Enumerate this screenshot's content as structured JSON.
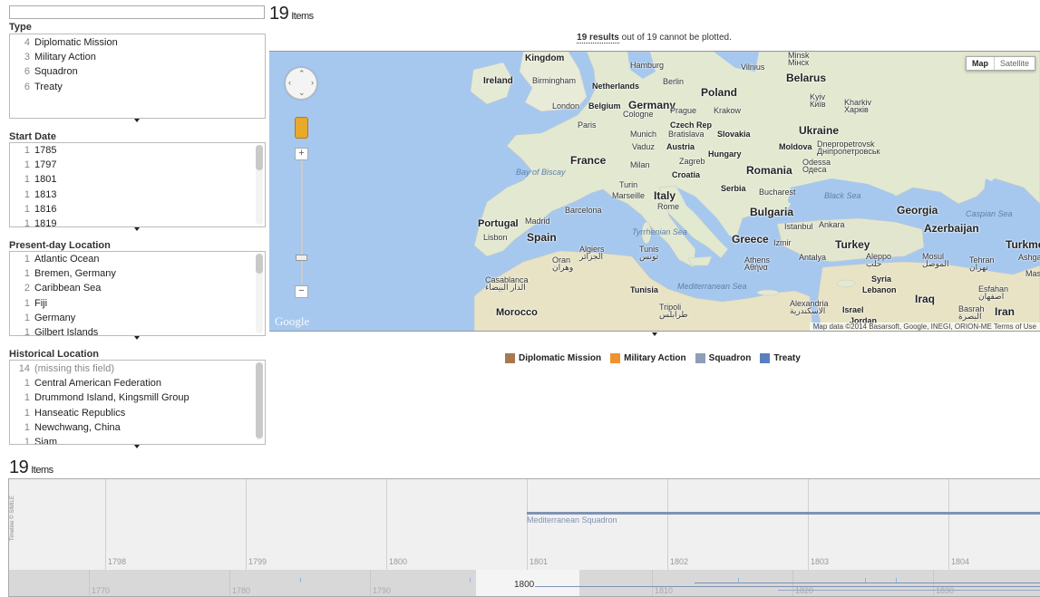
{
  "header": {
    "items_count": "19",
    "items_word": "Items"
  },
  "facets": {
    "type": {
      "title": "Type",
      "rows": [
        {
          "count": "4",
          "label": "Diplomatic Mission"
        },
        {
          "count": "3",
          "label": "Military Action"
        },
        {
          "count": "6",
          "label": "Squadron"
        },
        {
          "count": "6",
          "label": "Treaty"
        }
      ]
    },
    "start_date": {
      "title": "Start Date",
      "rows": [
        {
          "count": "1",
          "label": "1785"
        },
        {
          "count": "1",
          "label": "1797"
        },
        {
          "count": "1",
          "label": "1801"
        },
        {
          "count": "1",
          "label": "1813"
        },
        {
          "count": "1",
          "label": "1816"
        },
        {
          "count": "1",
          "label": "1819"
        }
      ]
    },
    "present_location": {
      "title": "Present-day Location",
      "rows": [
        {
          "count": "1",
          "label": "Atlantic Ocean"
        },
        {
          "count": "1",
          "label": "Bremen, Germany"
        },
        {
          "count": "2",
          "label": "Caribbean Sea"
        },
        {
          "count": "1",
          "label": "Fiji"
        },
        {
          "count": "1",
          "label": "Germany"
        },
        {
          "count": "1",
          "label": "Gilbert Islands"
        }
      ]
    },
    "historical_location": {
      "title": "Historical Location",
      "rows": [
        {
          "count": "14",
          "label": "(missing this field)"
        },
        {
          "count": "1",
          "label": "Central American Federation"
        },
        {
          "count": "1",
          "label": "Drummond Island, Kingsmill Group"
        },
        {
          "count": "1",
          "label": "Hanseatic Republics"
        },
        {
          "count": "1",
          "label": "Newchwang, China"
        },
        {
          "count": "1",
          "label": "Siam"
        }
      ]
    }
  },
  "map": {
    "results_link": "19 results",
    "results_rest": " out of 19 cannot be plotted.",
    "type_map": "Map",
    "type_satellite": "Satellite",
    "logo": "Google",
    "attribution": "Map data ©2014 Basarsoft, Google, INEGI, ORION-ME    Terms of Use",
    "labels": {
      "kingdom": "Kingdom",
      "ireland": "Ireland",
      "birmingham": "Birmingham",
      "london": "London",
      "netherlands": "Netherlands",
      "hamburg": "Hamburg",
      "berlin": "Berlin",
      "belgium": "Belgium",
      "germany": "Germany",
      "cologne": "Cologne",
      "poland": "Poland",
      "vilnius": "Vilnius",
      "minsk": "Minsk\nМінск",
      "belarus": "Belarus",
      "prague": "Prague",
      "krakow": "Krakow",
      "czech": "Czech Rep",
      "kyiv": "Kyiv\nКиїв",
      "kharkiv": "Kharkiv\nХарків",
      "paris": "Paris",
      "munich": "Munich",
      "bratislava": "Bratislava",
      "slovakia": "Slovakia",
      "vaduz": "Vaduz",
      "austria": "Austria",
      "ukraine": "Ukraine",
      "moldova": "Moldova",
      "dnipro": "Dnepropetrovsk\nДніпропетровськ",
      "france": "France",
      "milan": "Milan",
      "zagreb": "Zagreb",
      "hungary": "Hungary",
      "croatia": "Croatia",
      "romania": "Romania",
      "odessa": "Odessa\nОдеса",
      "biscay": "Bay of Biscay",
      "turin": "Turin",
      "serbia": "Serbia",
      "bucharest": "Bucharest",
      "marseille": "Marseille",
      "italy": "Italy",
      "rome": "Rome",
      "black_sea": "Black Sea",
      "georgia": "Georgia",
      "caspian": "Caspian Sea",
      "barcelona": "Barcelona",
      "bulgaria": "Bulgaria",
      "azerbaijan": "Azerbaijan",
      "portugal": "Portugal",
      "madrid": "Madrid",
      "lisbon": "Lisbon",
      "spain": "Spain",
      "tyrrhenian": "Tyrrhenian Sea",
      "greece": "Greece",
      "istanbul": "Istanbul",
      "ankara": "Ankara",
      "izmir": "Izmir",
      "turkey": "Turkey",
      "turkmen": "Turkme",
      "algiers": "Algiers\nالجزائر",
      "tunis": "Tunis\nتونس",
      "oran": "Oran\nوهران",
      "athens": "Athens\nΑθήνα",
      "antalya": "Antalya",
      "aleppo": "Aleppo\nحلب",
      "mosul": "Mosul\nالموصل",
      "tehran": "Tehran\nتهران",
      "ashgabat": "Ashga",
      "mashhad": "Mas",
      "syria": "Syria",
      "casablanca": "Casablanca\nالدار البيضاء",
      "tunisia": "Tunisia",
      "mediterranean": "Mediterranean Sea",
      "lebanon": "Lebanon",
      "esfahan": "Esfahan\nاصفهان",
      "iraq": "Iraq",
      "morocco": "Morocco",
      "tripoli": "Tripoli\nطرابلس",
      "alexandria": "Alexandria\nالاسكندرية",
      "israel": "Israel",
      "jordan": "Jordan",
      "basrah": "Basrah\nالبصرة",
      "iran": "Iran"
    }
  },
  "legend": [
    {
      "label": "Diplomatic Mission",
      "color": "#a87850"
    },
    {
      "label": "Military Action",
      "color": "#f0922e"
    },
    {
      "label": "Squadron",
      "color": "#8e9db8"
    },
    {
      "label": "Treaty",
      "color": "#5a7fc0"
    }
  ],
  "timeline": {
    "items_count": "19",
    "items_word": "Items",
    "credit": "Timeline © SIMILE",
    "upper_years": [
      "1798",
      "1799",
      "1800",
      "1801",
      "1802",
      "1803",
      "1804"
    ],
    "bar_label": "Mediterranean Squadron",
    "lower_years": [
      "1770",
      "1780",
      "1790",
      "1810",
      "1820",
      "1830"
    ],
    "center_year": "1800"
  }
}
